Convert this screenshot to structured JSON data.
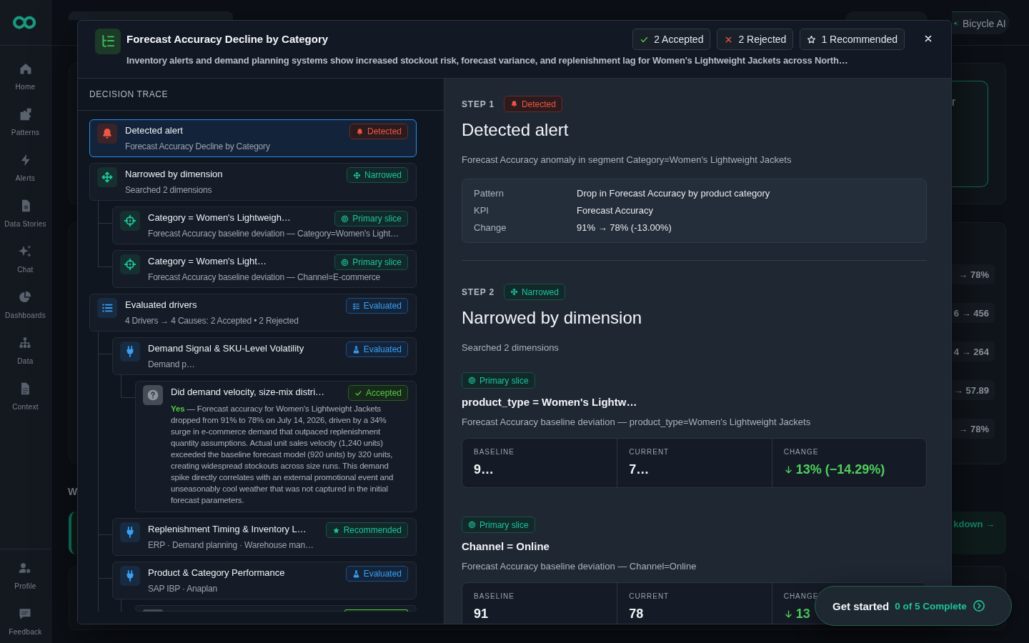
{
  "sidebar": {
    "nav": [
      {
        "label": "Home"
      },
      {
        "label": "Patterns"
      },
      {
        "label": "Alerts"
      },
      {
        "label": "Data Stories"
      },
      {
        "label": "Chat"
      },
      {
        "label": "Dashboards"
      },
      {
        "label": "Data"
      },
      {
        "label": "Context"
      }
    ],
    "footer": [
      {
        "label": "Profile"
      },
      {
        "label": "Feedback"
      }
    ]
  },
  "background": {
    "assistant_button": "Bicycle AI",
    "highlight_card": "r",
    "value_pills": [
      "→ 78%",
      "6 → 456",
      "4 → 264",
      "→ 57.89",
      "→ 78%"
    ],
    "section_heading": "W",
    "banner_link": "kdown →"
  },
  "modal": {
    "title": "Forecast Accuracy Decline by Category",
    "subtitle": "Inventory alerts and demand planning systems show increased stockout risk, forecast variance, and replenishment lag for Women's Lightweight Jackets across North…",
    "summary_chips": [
      {
        "kind": "accepted",
        "label": "2 Accepted"
      },
      {
        "kind": "rejected",
        "label": "2 Rejected"
      },
      {
        "kind": "recommended",
        "label": "1 Recommended"
      }
    ],
    "trace": {
      "heading": "DECISION TRACE",
      "items": [
        {
          "kind": "alert",
          "selected": true,
          "title": "Detected alert",
          "subtitle": "Forecast Accuracy Decline by Category",
          "badge": {
            "kind": "detected",
            "label": "Detected"
          }
        },
        {
          "kind": "dimension",
          "selected": false,
          "title": "Narrowed by dimension",
          "subtitle": "Searched 2 dimensions",
          "badge": {
            "kind": "narrowed",
            "label": "Narrowed"
          },
          "children": [
            {
              "kind": "slice",
              "selected": false,
              "title": "Category = Women's Lightweigh…",
              "subtitle": "Forecast Accuracy baseline deviation — Category=Women's Light…",
              "badge": {
                "kind": "slice",
                "label": "Primary slice"
              }
            },
            {
              "kind": "slice",
              "selected": false,
              "title": "Category = Women's Light…",
              "subtitle": "Forecast Accuracy baseline deviation — Channel=E-commerce",
              "badge": {
                "kind": "slice",
                "label": "Primary slice"
              }
            }
          ]
        },
        {
          "kind": "drivers",
          "selected": false,
          "title": "Evaluated drivers",
          "subtitle": "4 Drivers → 4 Causes: 2 Accepted • 2 Rejected",
          "badge": {
            "kind": "evaluated",
            "label": "Evaluated"
          },
          "more_below": true,
          "children": [
            {
              "kind": "driver",
              "selected": false,
              "title": "Demand Signal & SKU-Level Volatility",
              "subtitle": "Demand p…",
              "badge": {
                "kind": "experiment",
                "label": "Evaluated"
              },
              "children": [
                {
                  "kind": "question",
                  "selected": false,
                  "title": "Did demand velocity, size-mix distri…",
                  "answer": "**Yes** — Forecast accuracy for Women's Lightweight Jackets dropped from 91% to 78% on July 14, 2026, driven by a 34% surge in e-commerce demand that outpaced replenishment quantity assumptions. Actual unit sales velocity (1,240 units) exceeded the baseline forecast model (920 units) by 320 units, creating widespread stockouts across size runs. This demand spike directly correlates with an external promotional event and unseasonably cool weather that was not captured in the initial forecast parameters.",
                  "badge": {
                    "kind": "accepted",
                    "label": "Accepted"
                  }
                }
              ]
            },
            {
              "kind": "driver",
              "selected": false,
              "title": "Replenishment Timing & Inventory L…",
              "subtitle": "ERP · Demand planning · Warehouse man…",
              "badge": {
                "kind": "recommended",
                "label": "Recommended"
              }
            },
            {
              "kind": "driver",
              "selected": false,
              "title": "Product & Category Performance",
              "subtitle": "SAP IBP · Anaplan",
              "badge": {
                "kind": "experiment",
                "label": "Evaluated"
              },
              "children": [
                {
                  "kind": "question",
                  "selected": false,
                  "badge": {
                    "kind": "accepted"
                  }
                }
              ]
            }
          ]
        }
      ]
    },
    "steps": [
      {
        "kind": "alert",
        "label": "STEP 1",
        "badge": {
          "kind": "detected",
          "label": "Detected"
        },
        "title": "Detected alert",
        "description": "Forecast Accuracy anomaly in segment Category=Women's Lightweight Jackets",
        "details": [
          {
            "label": "Pattern",
            "value": "Drop in Forecast Accuracy by product category"
          },
          {
            "label": "KPI",
            "value": "Forecast Accuracy"
          },
          {
            "label": "Change",
            "value": "91% → 78% (-13.00%)"
          }
        ]
      },
      {
        "kind": "dimension",
        "label": "STEP 2",
        "badge": {
          "kind": "narrowed",
          "label": "Narrowed"
        },
        "title": "Narrowed by dimension",
        "description": "Searched 2 dimensions",
        "slices": [
          {
            "badge": {
              "kind": "slice",
              "label": "Primary slice"
            },
            "title": "product_type = Women's Lightw…",
            "description": "Forecast Accuracy baseline deviation — product_type=Women's Lightweight Jackets",
            "metrics": [
              {
                "kind": "plain",
                "label": "BASELINE",
                "value": "9…"
              },
              {
                "kind": "plain",
                "label": "CURRENT",
                "value": "7…"
              },
              {
                "kind": "decrease",
                "label": "CHANGE",
                "value": "13% (−14.29%)"
              }
            ]
          },
          {
            "badge": {
              "kind": "slice",
              "label": "Primary slice"
            },
            "title": "Channel = Online",
            "description": "Forecast Accuracy baseline deviation — Channel=Online",
            "metrics": [
              {
                "kind": "plain",
                "label": "BASELINE",
                "value": "91"
              },
              {
                "kind": "plain",
                "label": "CURRENT",
                "value": "78"
              },
              {
                "kind": "decrease",
                "label": "CHANGE",
                "value": "13"
              }
            ]
          }
        ]
      }
    ]
  },
  "onboarding": {
    "label": "Get started",
    "progress": "0 of 5 Complete"
  }
}
